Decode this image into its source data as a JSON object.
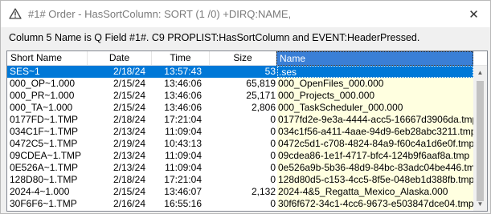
{
  "window": {
    "title": "#1# Order - HasSortColumn: SORT (1 /0) +DIRQ:NAME,"
  },
  "message": "Column 5 Name is Q Field #1#. C9 PROPLIST:HasSortColumn and EVENT:HeaderPressed.",
  "columns": [
    "Short Name",
    "Date",
    "Time",
    "Size",
    "Name"
  ],
  "sorted_column": "Name",
  "rows": [
    {
      "short": "SES~1",
      "date": "2/18/24",
      "time": "13:57:43",
      "size": "53",
      "name": ".ses",
      "selected": true
    },
    {
      "short": "000_OP~1.000",
      "date": "2/15/24",
      "time": "13:46:06",
      "size": "65,819",
      "name": "000_OpenFiles_000.000"
    },
    {
      "short": "000_PR~1.000",
      "date": "2/15/24",
      "time": "13:46:06",
      "size": "25,171",
      "name": "000_Projects_000.000"
    },
    {
      "short": "000_TA~1.000",
      "date": "2/15/24",
      "time": "13:46:06",
      "size": "2,806",
      "name": "000_TaskScheduler_000.000"
    },
    {
      "short": "0177FD~1.TMP",
      "date": "2/18/24",
      "time": "17:21:04",
      "size": "0",
      "name": "0177fd2e-9e3a-4444-acc5-16667d3906da.tmp"
    },
    {
      "short": "034C1F~1.TMP",
      "date": "2/13/24",
      "time": "11:09:04",
      "size": "0",
      "name": "034c1f56-a411-4aae-94d9-6eb28abc3211.tmp"
    },
    {
      "short": "0472C5~1.TMP",
      "date": "2/19/24",
      "time": "10:43:13",
      "size": "0",
      "name": "0472c5d1-c708-4824-84a9-f60c4a1d6e0f.tmp"
    },
    {
      "short": "09CDEA~1.TMP",
      "date": "2/13/24",
      "time": "11:09:04",
      "size": "0",
      "name": "09cdea86-1e1f-4717-bfc4-124b9f6aaf8a.tmp"
    },
    {
      "short": "0E526A~1.TMP",
      "date": "2/13/24",
      "time": "11:09:04",
      "size": "0",
      "name": "0e526a9b-5b36-48d9-84bc-83adc04be446.tmp"
    },
    {
      "short": "128D80~1.TMP",
      "date": "2/18/24",
      "time": "17:21:04",
      "size": "0",
      "name": "128d80d5-c153-4cc5-8f5e-048eb1d388fb.tmp"
    },
    {
      "short": "2024-4~1.000",
      "date": "2/15/24",
      "time": "13:46:07",
      "size": "2,132",
      "name": "2024-4&5_Regatta_Mexico_Alaska.000"
    },
    {
      "short": "30F6F6~1.TMP",
      "date": "2/16/24",
      "time": "16:55:16",
      "size": "0",
      "name": "30f6f672-34c1-4cc6-9673-e503847dce04.tmp"
    }
  ],
  "colors": {
    "selection": "#0078d7",
    "name_column_bg": "#ffffe0",
    "sorted_header": "#3a7fd6"
  },
  "icons": {
    "window": "warning-triangle-icon",
    "close": "close-icon",
    "scroll_up": "chevron-up-icon",
    "scroll_down": "chevron-down-icon"
  }
}
